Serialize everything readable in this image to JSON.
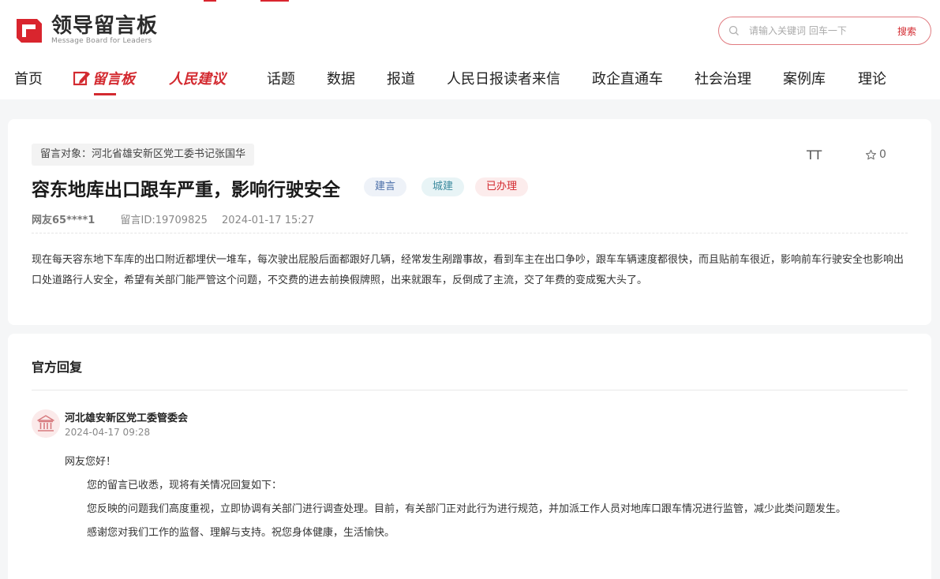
{
  "header": {
    "logo_cn": "领导留言板",
    "logo_en": "Message Board for Leaders",
    "search_placeholder": "请输入关键词 回车一下",
    "search_button": "搜索",
    "accent": "#d32a30"
  },
  "nav": {
    "items": [
      "首页",
      "留言板",
      "人民建议",
      "话题",
      "数据",
      "报道",
      "人民日报读者来信",
      "政企直通车",
      "社会治理",
      "案例库",
      "理论"
    ],
    "active": "留言板"
  },
  "message": {
    "target": "留言对象：河北省雄安新区党工委书记张国华",
    "title": "容东地库出口跟车严重，影响行驶安全",
    "tags": [
      "建言",
      "城建",
      "已办理"
    ],
    "font_icon_label": "TT",
    "star_count": "0",
    "user": "网友65****1",
    "message_id": "留言ID:19709825",
    "datetime": "2024-01-17 15:27",
    "content": "现在每天容东地下车库的出口附近都埋伏一堆车，每次驶出屁股后面都跟好几辆，经常发生剐蹭事故，看到车主在出口争吵，跟车车辆速度都很快，而且贴前车很近，影响前车行驶安全也影响出口处道路行人安全，希望有关部门能严管这个问题，不交费的进去前换假牌照，出来就跟车，反倒成了主流，交了年费的变成冤大头了。"
  },
  "reply": {
    "heading": "官方回复",
    "org": "河北雄安新区党工委管委会",
    "date": "2024-04-17 09:28",
    "lines": [
      "网友您好！",
      "您的留言已收悉，现将有关情况回复如下：",
      "您反映的问题我们高度重视，立即协调有关部门进行调查处理。目前，有关部门正对此行为进行规范，并加派工作人员对地库口跟车情况进行监管，减少此类问题发生。",
      "感谢您对我们工作的监督、理解与支持。祝您身体健康，生活愉快。"
    ]
  }
}
